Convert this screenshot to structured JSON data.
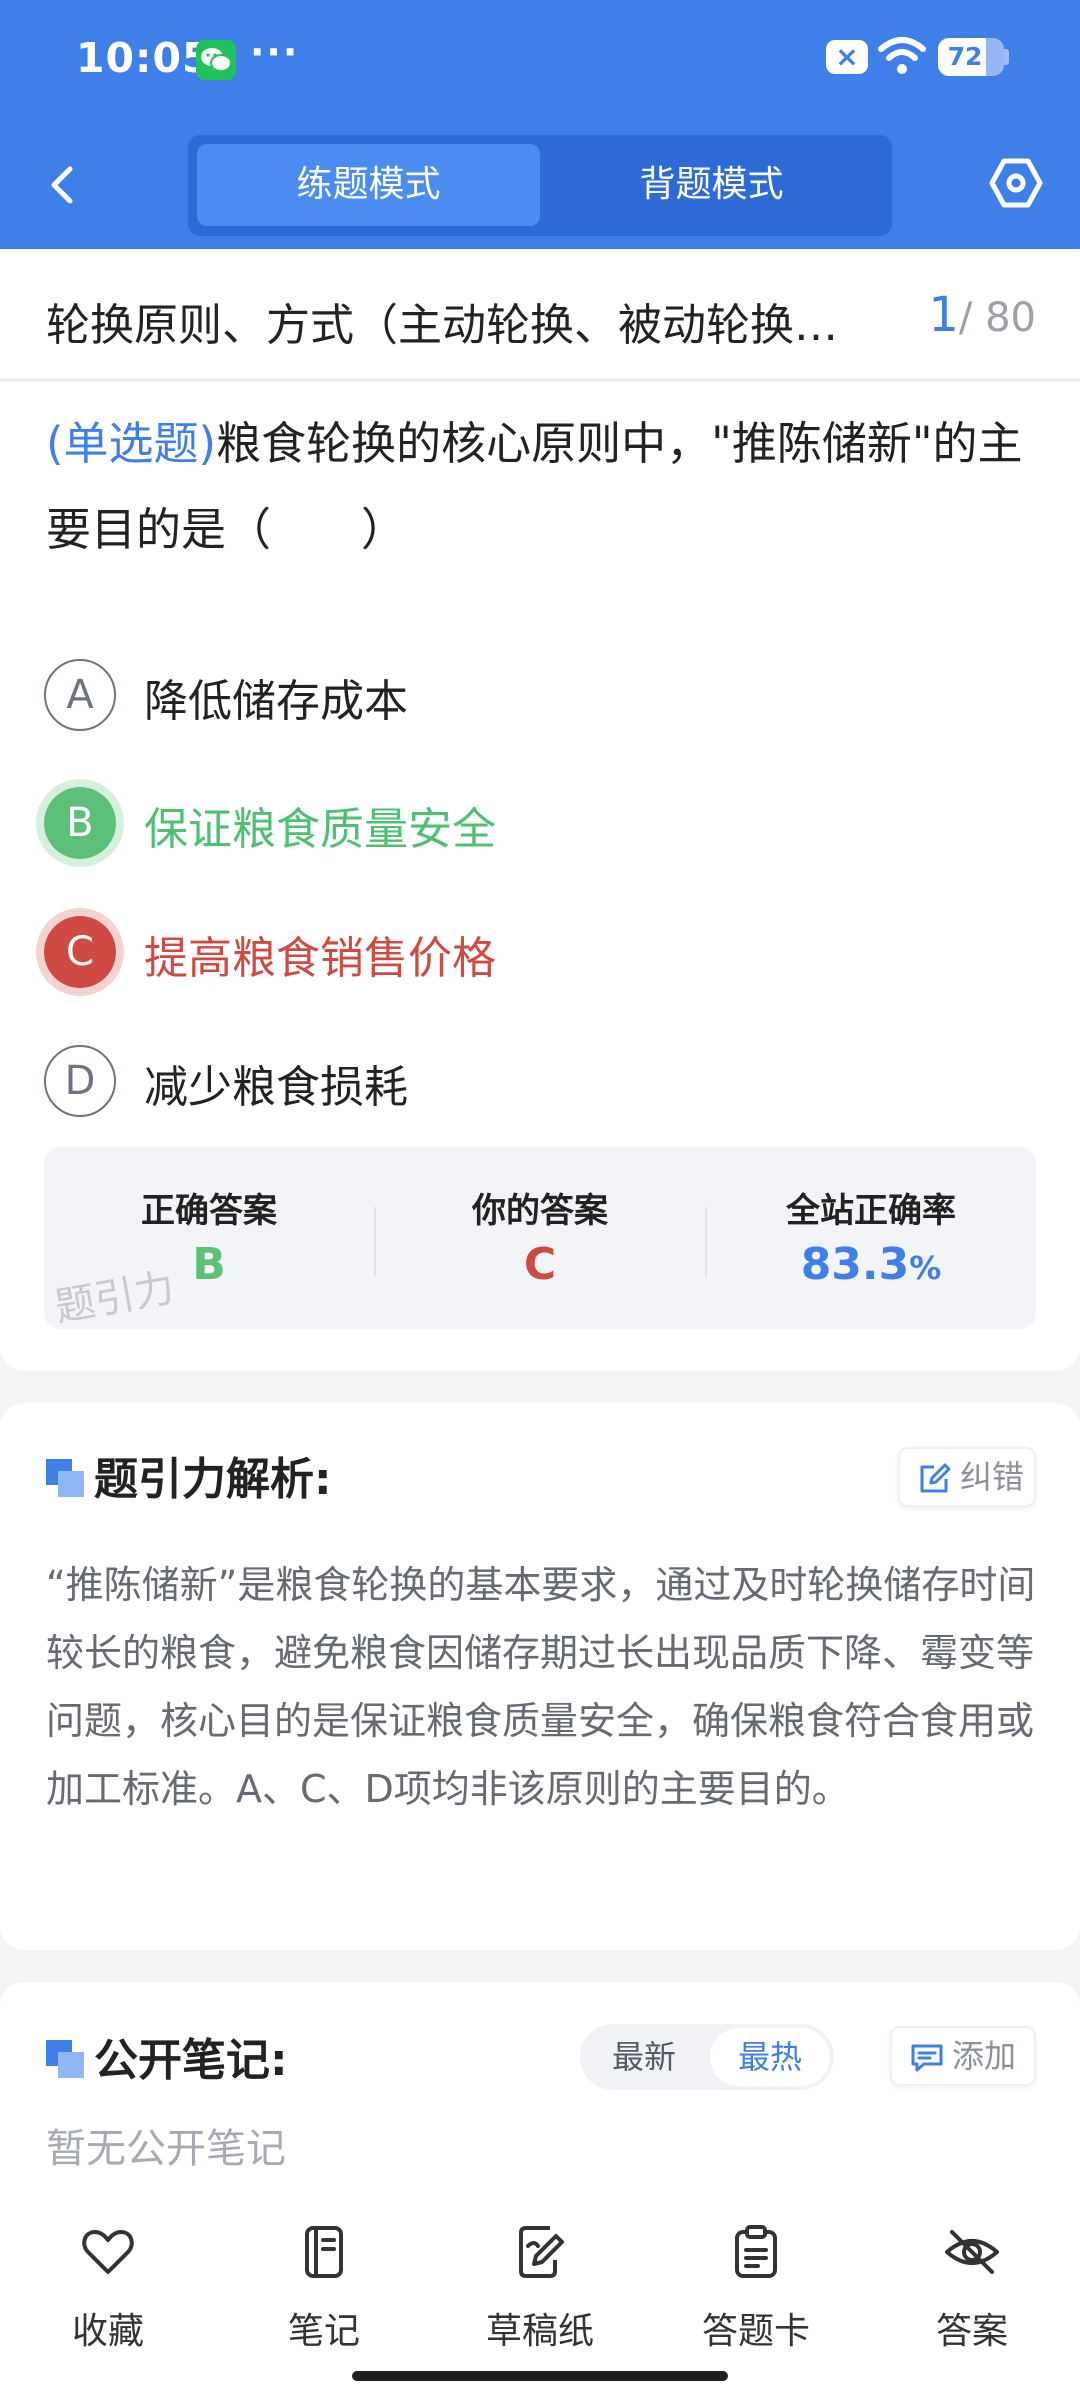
{
  "status_bar": {
    "time": "10:05",
    "more": "···",
    "battery": "72",
    "battery_level": 0.72
  },
  "header": {
    "tabs": [
      {
        "label": "练题模式",
        "active": true
      },
      {
        "label": "背题模式",
        "active": false
      }
    ]
  },
  "question": {
    "chapter": "轮换原则、方式（主动轮换、被动轮换…",
    "index": "1",
    "total": "/ 80",
    "type_label": "(单选题)",
    "text": "粮食轮换的核心原则中，\"推陈储新\"的主要目的是（　　）",
    "options": [
      {
        "letter": "A",
        "text": "降低储存成本",
        "state": "normal"
      },
      {
        "letter": "B",
        "text": "保证粮食质量安全",
        "state": "correct"
      },
      {
        "letter": "C",
        "text": "提高粮食销售价格",
        "state": "wrong"
      },
      {
        "letter": "D",
        "text": "减少粮食损耗",
        "state": "normal"
      }
    ]
  },
  "answer_summary": {
    "correct_label": "正确答案",
    "correct_value": "B",
    "yours_label": "你的答案",
    "yours_value": "C",
    "rate_label": "全站正确率",
    "rate_value": "83.3",
    "rate_unit": "%",
    "watermark": "题引力"
  },
  "analysis": {
    "title": "题引力解析:",
    "report_button": "纠错",
    "text": "“推陈储新”是粮食轮换的基本要求，通过及时轮换储存时间较长的粮食，避免粮食因储存期过长出现品质下降、霉变等问题，核心目的是保证粮食质量安全，确保粮食符合食用或加工标准。A、C、D项均非该原则的主要目的。"
  },
  "notes": {
    "title": "公开笔记:",
    "sort_latest": "最新",
    "sort_hot": "最热",
    "add_button": "添加",
    "empty_text": "暂无公开笔记"
  },
  "toolbar": {
    "favorite": "收藏",
    "note": "笔记",
    "draft": "草稿纸",
    "answer_card": "答题卡",
    "answer": "答案"
  },
  "colors": {
    "primary": "#3f7fe8",
    "correct": "#5cc078",
    "wrong": "#cf4a43",
    "text": "#222222",
    "muted": "#9aa0a8"
  }
}
